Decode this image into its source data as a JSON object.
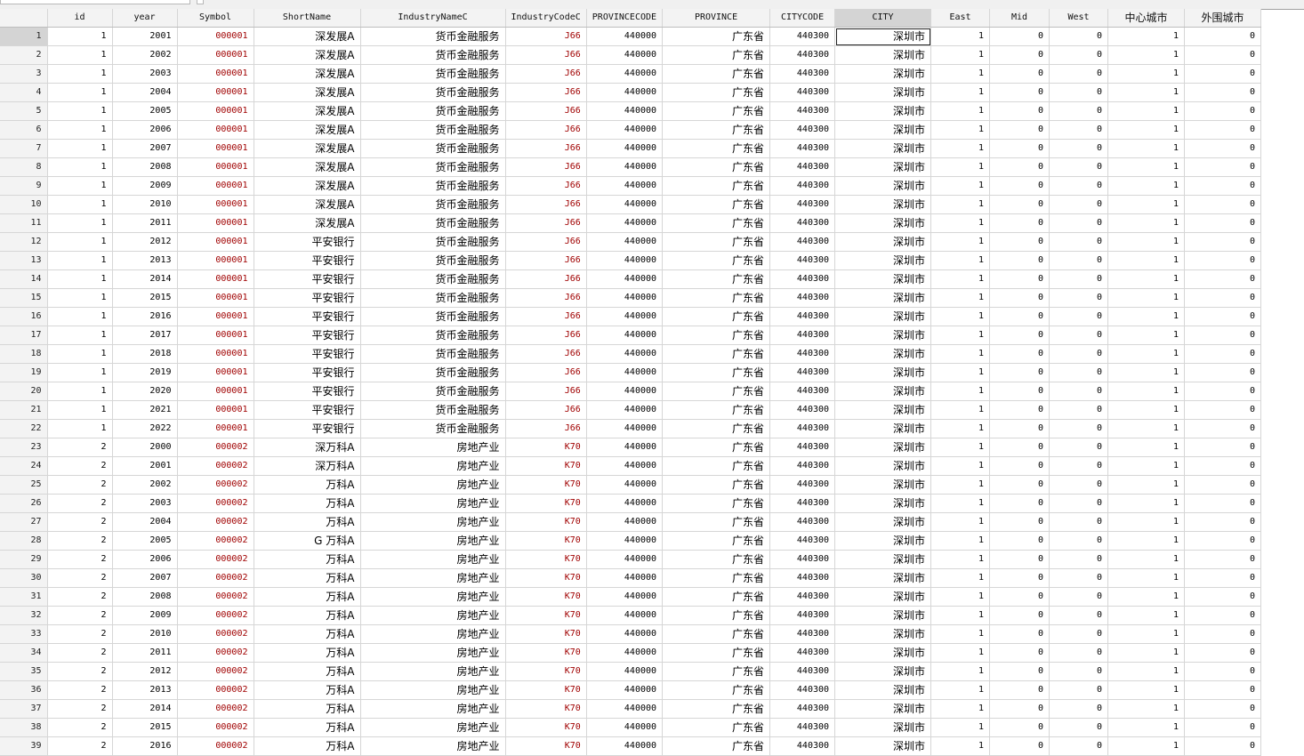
{
  "columns": [
    "id",
    "year",
    "Symbol",
    "ShortName",
    "IndustryNameC",
    "IndustryCodeC",
    "PROVINCECODE",
    "PROVINCE",
    "CITYCODE",
    "CITY",
    "East",
    "Mid",
    "West",
    "中心城市",
    "外围城市"
  ],
  "selected_column": "CITY",
  "active_cell": {
    "row": 1,
    "column": "CITY"
  },
  "rows": [
    [
      "1",
      "1",
      "2001",
      "000001",
      "深发展A",
      "货币金融服务",
      "J66",
      "440000",
      "广东省",
      "440300",
      "深圳市",
      "1",
      "0",
      "0",
      "1",
      "0"
    ],
    [
      "2",
      "1",
      "2002",
      "000001",
      "深发展A",
      "货币金融服务",
      "J66",
      "440000",
      "广东省",
      "440300",
      "深圳市",
      "1",
      "0",
      "0",
      "1",
      "0"
    ],
    [
      "3",
      "1",
      "2003",
      "000001",
      "深发展A",
      "货币金融服务",
      "J66",
      "440000",
      "广东省",
      "440300",
      "深圳市",
      "1",
      "0",
      "0",
      "1",
      "0"
    ],
    [
      "4",
      "1",
      "2004",
      "000001",
      "深发展A",
      "货币金融服务",
      "J66",
      "440000",
      "广东省",
      "440300",
      "深圳市",
      "1",
      "0",
      "0",
      "1",
      "0"
    ],
    [
      "5",
      "1",
      "2005",
      "000001",
      "深发展A",
      "货币金融服务",
      "J66",
      "440000",
      "广东省",
      "440300",
      "深圳市",
      "1",
      "0",
      "0",
      "1",
      "0"
    ],
    [
      "6",
      "1",
      "2006",
      "000001",
      "深发展A",
      "货币金融服务",
      "J66",
      "440000",
      "广东省",
      "440300",
      "深圳市",
      "1",
      "0",
      "0",
      "1",
      "0"
    ],
    [
      "7",
      "1",
      "2007",
      "000001",
      "深发展A",
      "货币金融服务",
      "J66",
      "440000",
      "广东省",
      "440300",
      "深圳市",
      "1",
      "0",
      "0",
      "1",
      "0"
    ],
    [
      "8",
      "1",
      "2008",
      "000001",
      "深发展A",
      "货币金融服务",
      "J66",
      "440000",
      "广东省",
      "440300",
      "深圳市",
      "1",
      "0",
      "0",
      "1",
      "0"
    ],
    [
      "9",
      "1",
      "2009",
      "000001",
      "深发展A",
      "货币金融服务",
      "J66",
      "440000",
      "广东省",
      "440300",
      "深圳市",
      "1",
      "0",
      "0",
      "1",
      "0"
    ],
    [
      "10",
      "1",
      "2010",
      "000001",
      "深发展A",
      "货币金融服务",
      "J66",
      "440000",
      "广东省",
      "440300",
      "深圳市",
      "1",
      "0",
      "0",
      "1",
      "0"
    ],
    [
      "11",
      "1",
      "2011",
      "000001",
      "深发展A",
      "货币金融服务",
      "J66",
      "440000",
      "广东省",
      "440300",
      "深圳市",
      "1",
      "0",
      "0",
      "1",
      "0"
    ],
    [
      "12",
      "1",
      "2012",
      "000001",
      "平安银行",
      "货币金融服务",
      "J66",
      "440000",
      "广东省",
      "440300",
      "深圳市",
      "1",
      "0",
      "0",
      "1",
      "0"
    ],
    [
      "13",
      "1",
      "2013",
      "000001",
      "平安银行",
      "货币金融服务",
      "J66",
      "440000",
      "广东省",
      "440300",
      "深圳市",
      "1",
      "0",
      "0",
      "1",
      "0"
    ],
    [
      "14",
      "1",
      "2014",
      "000001",
      "平安银行",
      "货币金融服务",
      "J66",
      "440000",
      "广东省",
      "440300",
      "深圳市",
      "1",
      "0",
      "0",
      "1",
      "0"
    ],
    [
      "15",
      "1",
      "2015",
      "000001",
      "平安银行",
      "货币金融服务",
      "J66",
      "440000",
      "广东省",
      "440300",
      "深圳市",
      "1",
      "0",
      "0",
      "1",
      "0"
    ],
    [
      "16",
      "1",
      "2016",
      "000001",
      "平安银行",
      "货币金融服务",
      "J66",
      "440000",
      "广东省",
      "440300",
      "深圳市",
      "1",
      "0",
      "0",
      "1",
      "0"
    ],
    [
      "17",
      "1",
      "2017",
      "000001",
      "平安银行",
      "货币金融服务",
      "J66",
      "440000",
      "广东省",
      "440300",
      "深圳市",
      "1",
      "0",
      "0",
      "1",
      "0"
    ],
    [
      "18",
      "1",
      "2018",
      "000001",
      "平安银行",
      "货币金融服务",
      "J66",
      "440000",
      "广东省",
      "440300",
      "深圳市",
      "1",
      "0",
      "0",
      "1",
      "0"
    ],
    [
      "19",
      "1",
      "2019",
      "000001",
      "平安银行",
      "货币金融服务",
      "J66",
      "440000",
      "广东省",
      "440300",
      "深圳市",
      "1",
      "0",
      "0",
      "1",
      "0"
    ],
    [
      "20",
      "1",
      "2020",
      "000001",
      "平安银行",
      "货币金融服务",
      "J66",
      "440000",
      "广东省",
      "440300",
      "深圳市",
      "1",
      "0",
      "0",
      "1",
      "0"
    ],
    [
      "21",
      "1",
      "2021",
      "000001",
      "平安银行",
      "货币金融服务",
      "J66",
      "440000",
      "广东省",
      "440300",
      "深圳市",
      "1",
      "0",
      "0",
      "1",
      "0"
    ],
    [
      "22",
      "1",
      "2022",
      "000001",
      "平安银行",
      "货币金融服务",
      "J66",
      "440000",
      "广东省",
      "440300",
      "深圳市",
      "1",
      "0",
      "0",
      "1",
      "0"
    ],
    [
      "23",
      "2",
      "2000",
      "000002",
      "深万科A",
      "房地产业",
      "K70",
      "440000",
      "广东省",
      "440300",
      "深圳市",
      "1",
      "0",
      "0",
      "1",
      "0"
    ],
    [
      "24",
      "2",
      "2001",
      "000002",
      "深万科A",
      "房地产业",
      "K70",
      "440000",
      "广东省",
      "440300",
      "深圳市",
      "1",
      "0",
      "0",
      "1",
      "0"
    ],
    [
      "25",
      "2",
      "2002",
      "000002",
      "万科A",
      "房地产业",
      "K70",
      "440000",
      "广东省",
      "440300",
      "深圳市",
      "1",
      "0",
      "0",
      "1",
      "0"
    ],
    [
      "26",
      "2",
      "2003",
      "000002",
      "万科A",
      "房地产业",
      "K70",
      "440000",
      "广东省",
      "440300",
      "深圳市",
      "1",
      "0",
      "0",
      "1",
      "0"
    ],
    [
      "27",
      "2",
      "2004",
      "000002",
      "万科A",
      "房地产业",
      "K70",
      "440000",
      "广东省",
      "440300",
      "深圳市",
      "1",
      "0",
      "0",
      "1",
      "0"
    ],
    [
      "28",
      "2",
      "2005",
      "000002",
      "G 万科A",
      "房地产业",
      "K70",
      "440000",
      "广东省",
      "440300",
      "深圳市",
      "1",
      "0",
      "0",
      "1",
      "0"
    ],
    [
      "29",
      "2",
      "2006",
      "000002",
      "万科A",
      "房地产业",
      "K70",
      "440000",
      "广东省",
      "440300",
      "深圳市",
      "1",
      "0",
      "0",
      "1",
      "0"
    ],
    [
      "30",
      "2",
      "2007",
      "000002",
      "万科A",
      "房地产业",
      "K70",
      "440000",
      "广东省",
      "440300",
      "深圳市",
      "1",
      "0",
      "0",
      "1",
      "0"
    ],
    [
      "31",
      "2",
      "2008",
      "000002",
      "万科A",
      "房地产业",
      "K70",
      "440000",
      "广东省",
      "440300",
      "深圳市",
      "1",
      "0",
      "0",
      "1",
      "0"
    ],
    [
      "32",
      "2",
      "2009",
      "000002",
      "万科A",
      "房地产业",
      "K70",
      "440000",
      "广东省",
      "440300",
      "深圳市",
      "1",
      "0",
      "0",
      "1",
      "0"
    ],
    [
      "33",
      "2",
      "2010",
      "000002",
      "万科A",
      "房地产业",
      "K70",
      "440000",
      "广东省",
      "440300",
      "深圳市",
      "1",
      "0",
      "0",
      "1",
      "0"
    ],
    [
      "34",
      "2",
      "2011",
      "000002",
      "万科A",
      "房地产业",
      "K70",
      "440000",
      "广东省",
      "440300",
      "深圳市",
      "1",
      "0",
      "0",
      "1",
      "0"
    ],
    [
      "35",
      "2",
      "2012",
      "000002",
      "万科A",
      "房地产业",
      "K70",
      "440000",
      "广东省",
      "440300",
      "深圳市",
      "1",
      "0",
      "0",
      "1",
      "0"
    ],
    [
      "36",
      "2",
      "2013",
      "000002",
      "万科A",
      "房地产业",
      "K70",
      "440000",
      "广东省",
      "440300",
      "深圳市",
      "1",
      "0",
      "0",
      "1",
      "0"
    ],
    [
      "37",
      "2",
      "2014",
      "000002",
      "万科A",
      "房地产业",
      "K70",
      "440000",
      "广东省",
      "440300",
      "深圳市",
      "1",
      "0",
      "0",
      "1",
      "0"
    ],
    [
      "38",
      "2",
      "2015",
      "000002",
      "万科A",
      "房地产业",
      "K70",
      "440000",
      "广东省",
      "440300",
      "深圳市",
      "1",
      "0",
      "0",
      "1",
      "0"
    ],
    [
      "39",
      "2",
      "2016",
      "000002",
      "万科A",
      "房地产业",
      "K70",
      "440000",
      "广东省",
      "440300",
      "深圳市",
      "1",
      "0",
      "0",
      "1",
      "0"
    ]
  ],
  "colors": {
    "string_text": "#a00000",
    "header_bg": "#f3f3f3",
    "selected_header_bg": "#d4d4d4"
  }
}
